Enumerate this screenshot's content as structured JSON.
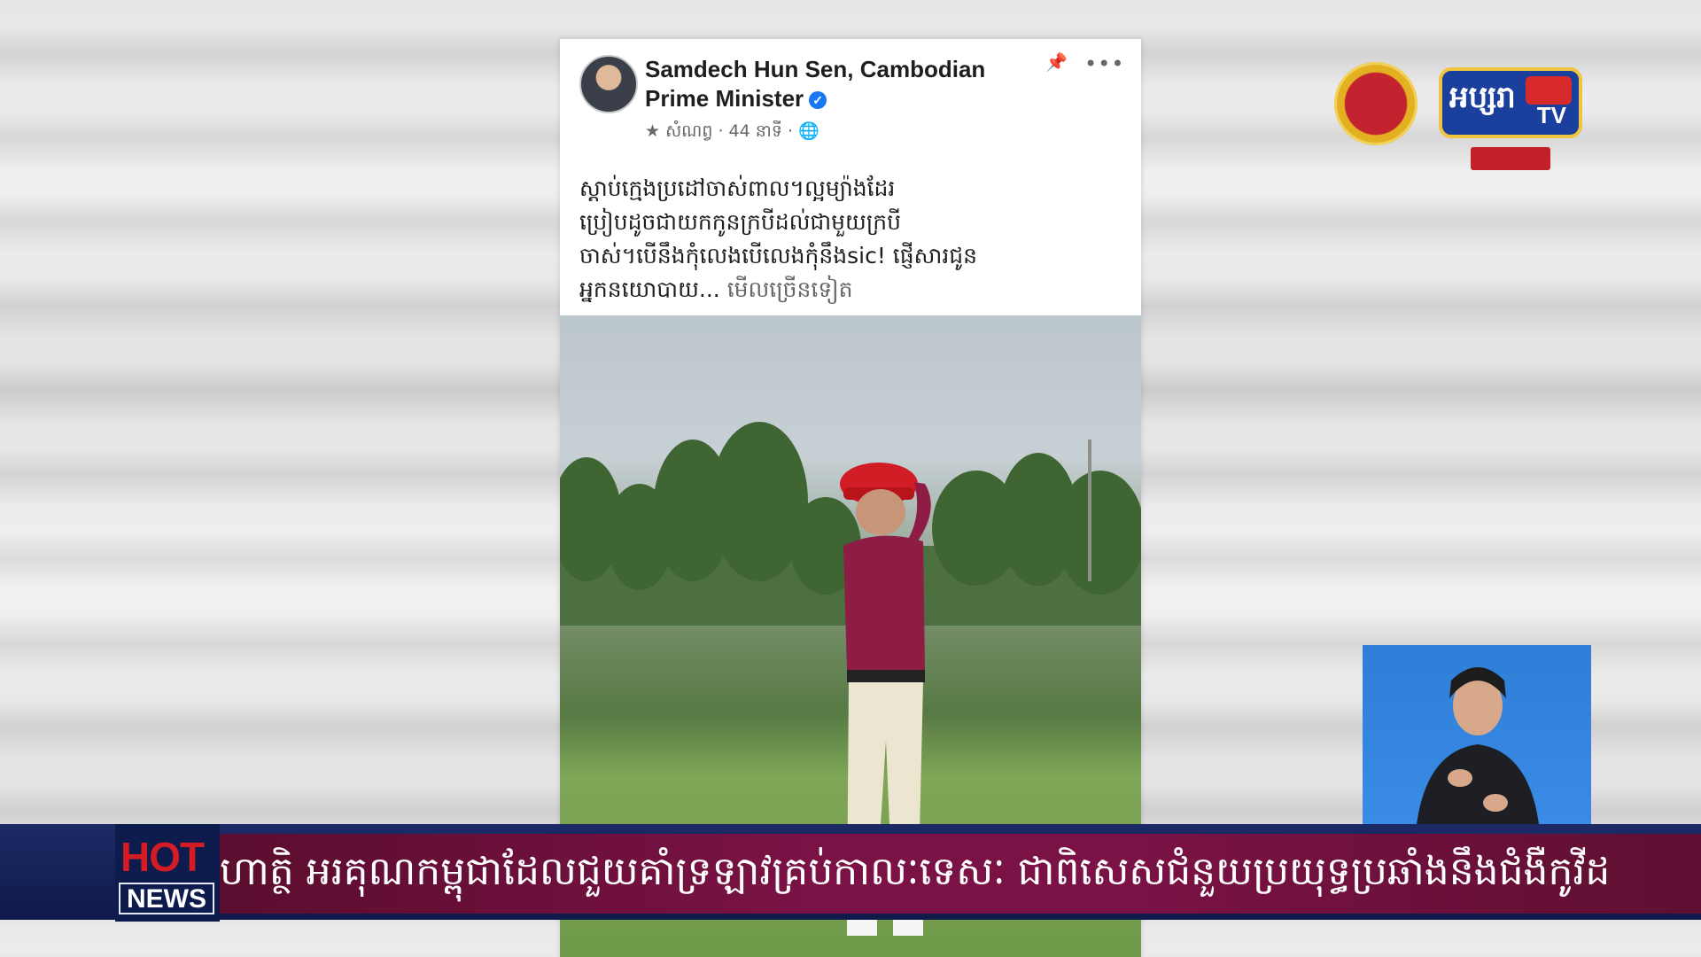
{
  "post": {
    "author_line1": "Samdech Hun Sen, Cambodian",
    "author_line2": "Prime Minister",
    "meta": "★ សំណព្វ · 44 នាទី · 🌐",
    "text_line1": "ស្តាប់ក្មេងប្រដៅចាស់ពាល។ល្អម្យ៉ាងដែរ",
    "text_line2": "ប្រៀបដូចជាយកកូនក្របីដល់ជាមួយក្របី",
    "text_line3": "ចាស់។បើនឹងកុំលេងបើលេងកុំនឹងsic! ផ្ញើសារជូន",
    "text_line4": "អ្នកនយោបាយ...",
    "see_more": "មើលច្រើនទៀត"
  },
  "channel": {
    "logo_text": "អប្សរា",
    "logo_tv": "TV"
  },
  "ticker": {
    "hot_label": "HOT",
    "news_label": "NEWS",
    "headline": "ហាត្ថិ អរគុណកម្ពុជាដែលជួយគាំទ្រឡាវគ្រប់កាលៈទេសៈ ជាពិសេសជំនួយប្រយុទ្ធប្រឆាំងនឹងជំងឺកូវីដ"
  },
  "colors": {
    "facebook_blue": "#1877f2",
    "ticker_purple": "#7a1245",
    "ticker_navy": "#0f1a4a",
    "hot_red": "#d41c25"
  }
}
